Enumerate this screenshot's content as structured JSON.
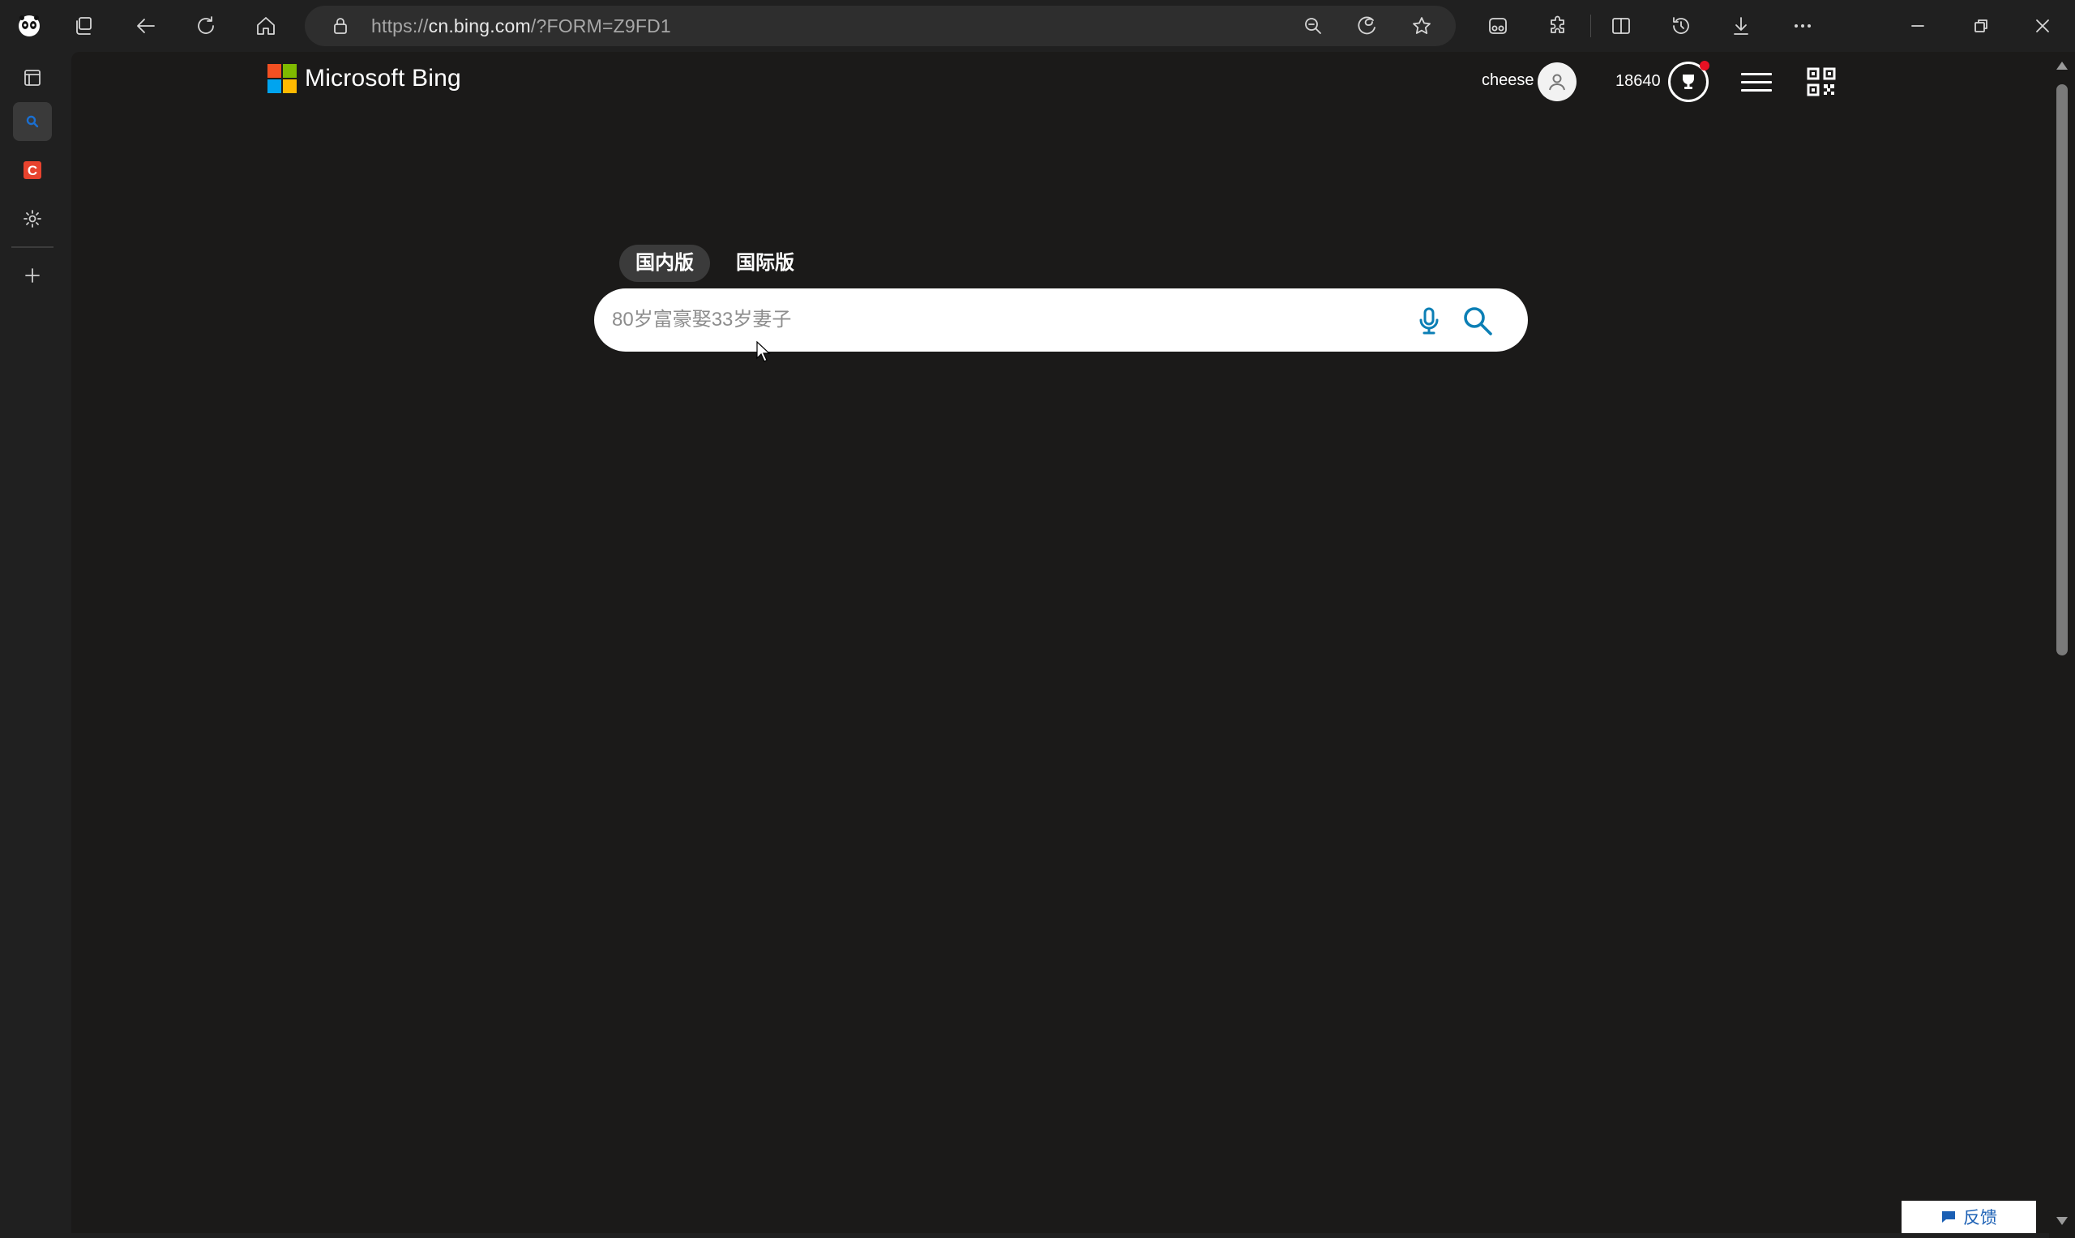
{
  "browser": {
    "url_prefix": "https://",
    "url_host": "cn.bing.com",
    "url_path": "/?FORM=Z9FD1"
  },
  "bing": {
    "logo_text": "Microsoft Bing",
    "logo_colors": [
      "#f25022",
      "#7fba00",
      "#00a4ef",
      "#ffb900"
    ],
    "user_name": "cheese",
    "points": "18640",
    "tabs": [
      {
        "label": "国内版",
        "active": true
      },
      {
        "label": "国际版",
        "active": false
      }
    ],
    "search_placeholder": "80岁富豪娶33岁妻子",
    "accent": "#0c7fb5"
  },
  "feedback": {
    "label": "反馈"
  }
}
